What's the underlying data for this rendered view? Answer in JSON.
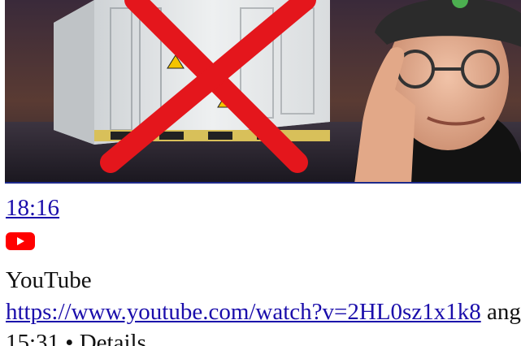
{
  "video": {
    "duration": "18:16",
    "source_name": "YouTube",
    "url": "https://www.youtube.com/watch?v=2HL0sz1x1k8",
    "url_suffix": " ang",
    "meta": "15:31 • Details"
  },
  "icons": {
    "platform": "youtube-play-icon"
  },
  "colors": {
    "link": "#1a0dab",
    "youtube_red": "#ff0000",
    "thumbnail_border": "#1d2a8a"
  }
}
